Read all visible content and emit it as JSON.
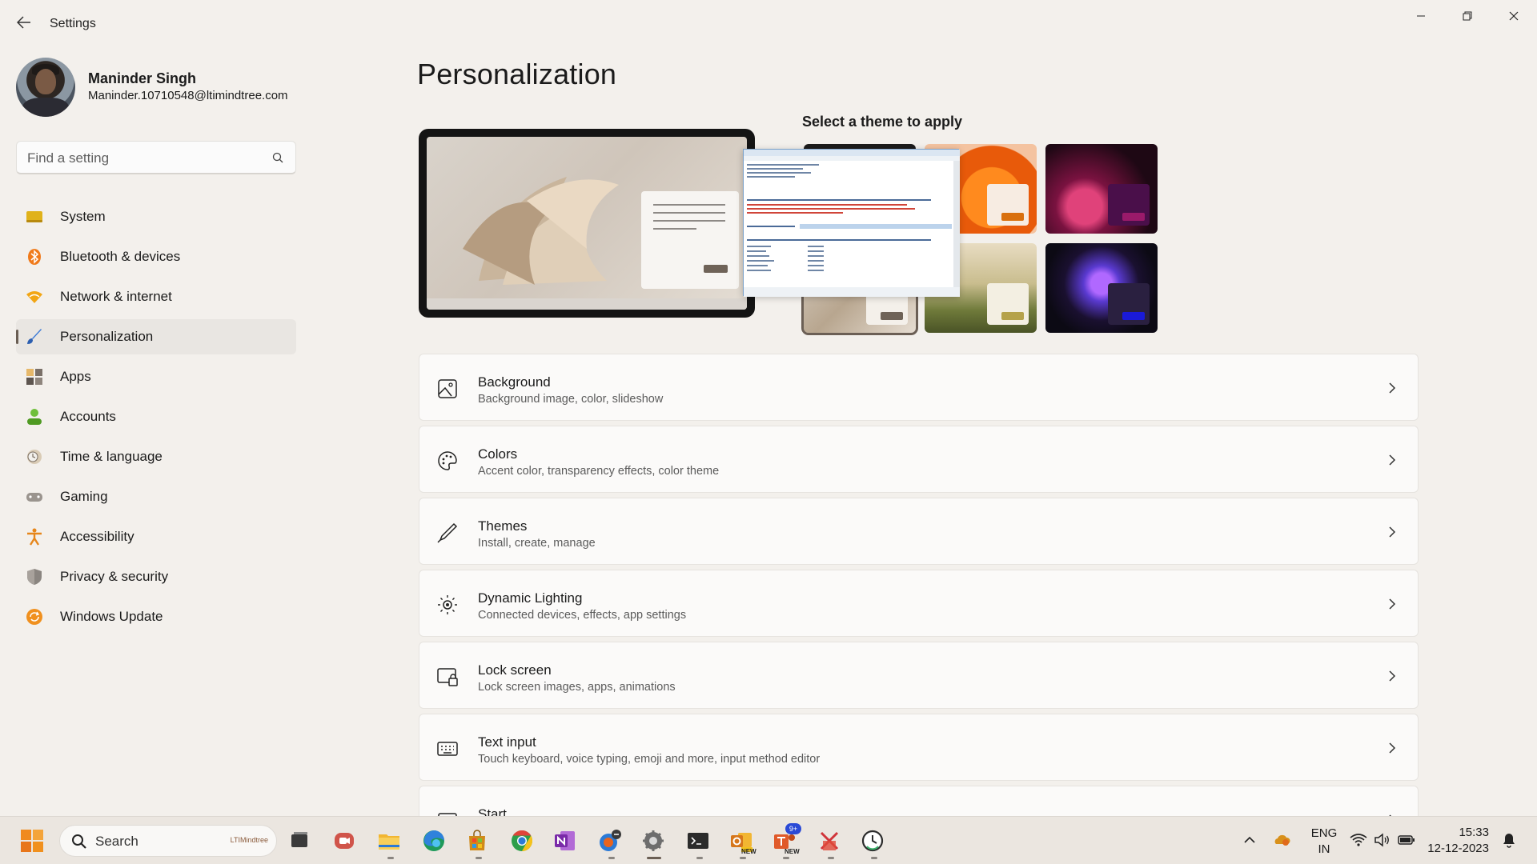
{
  "window": {
    "title": "Settings",
    "back_icon": "back-arrow-icon",
    "minimize_icon": "minimize-icon",
    "restore_icon": "restore-icon",
    "close_icon": "close-icon"
  },
  "profile": {
    "name": "Maninder Singh",
    "email": "Maninder.10710548@ltimindtree.com"
  },
  "search": {
    "placeholder": "Find a setting"
  },
  "sidebar": {
    "items": [
      {
        "label": "System",
        "icon": "system-icon"
      },
      {
        "label": "Bluetooth & devices",
        "icon": "bluetooth-icon"
      },
      {
        "label": "Network & internet",
        "icon": "wifi-icon"
      },
      {
        "label": "Personalization",
        "icon": "brush-icon",
        "active": true
      },
      {
        "label": "Apps",
        "icon": "apps-icon"
      },
      {
        "label": "Accounts",
        "icon": "person-icon"
      },
      {
        "label": "Time & language",
        "icon": "clock-globe-icon"
      },
      {
        "label": "Gaming",
        "icon": "gamepad-icon"
      },
      {
        "label": "Accessibility",
        "icon": "accessibility-icon"
      },
      {
        "label": "Privacy & security",
        "icon": "shield-icon"
      },
      {
        "label": "Windows Update",
        "icon": "update-icon"
      }
    ]
  },
  "main": {
    "title": "Personalization",
    "themes_heading": "Select a theme to apply",
    "cards": [
      {
        "title": "Background",
        "subtitle": "Background image, color, slideshow",
        "icon": "image-icon"
      },
      {
        "title": "Colors",
        "subtitle": "Accent color, transparency effects, color theme",
        "icon": "palette-icon"
      },
      {
        "title": "Themes",
        "subtitle": "Install, create, manage",
        "icon": "pen-icon"
      },
      {
        "title": "Dynamic Lighting",
        "subtitle": "Connected devices, effects, app settings",
        "icon": "lighting-icon"
      },
      {
        "title": "Lock screen",
        "subtitle": "Lock screen images, apps, animations",
        "icon": "lock-screen-icon"
      },
      {
        "title": "Text input",
        "subtitle": "Touch keyboard, voice typing, emoji and more, input method editor",
        "icon": "keyboard-icon"
      },
      {
        "title": "Start",
        "subtitle": "",
        "icon": "start-icon"
      }
    ]
  },
  "taskbar": {
    "search_label": "Search",
    "search_logo_text": "LTIMindtree",
    "language_line1": "ENG",
    "language_line2": "IN",
    "time": "15:33",
    "date": "12-12-2023",
    "badge_teams_count": "9+",
    "badge_new_1": "NEW",
    "badge_new_2": "NEW"
  },
  "colors": {
    "background": "#f3f0ec",
    "accent": "#6a5e53"
  }
}
